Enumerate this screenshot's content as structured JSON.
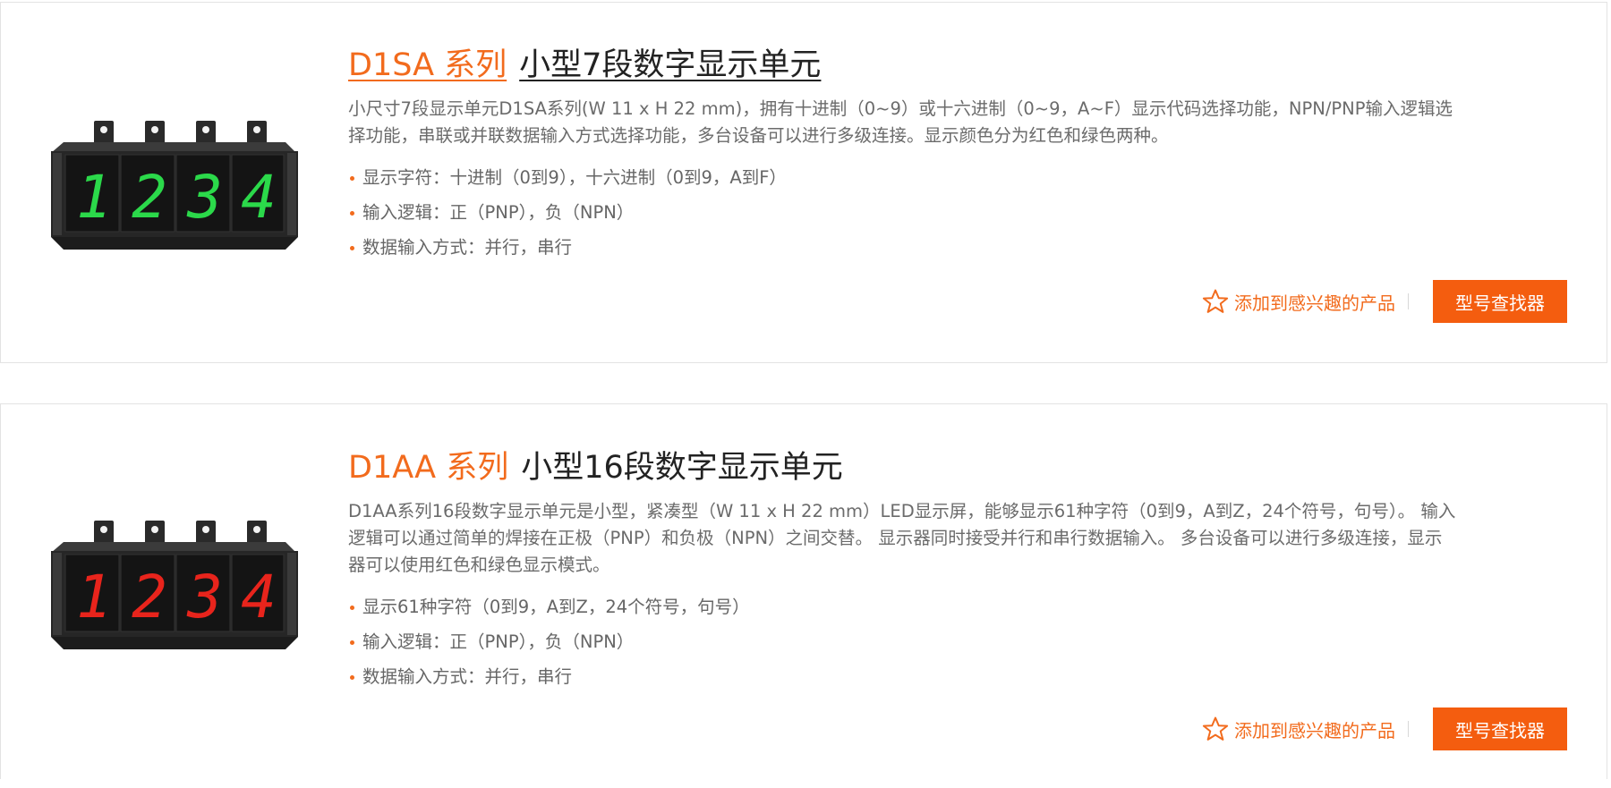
{
  "products": [
    {
      "series": "D1SA 系列",
      "subtitle": "小型7段数字显示单元",
      "description": "小尺寸7段显示单元D1SA系列(W 11 x H 22 mm)，拥有十进制（0~9）或十六进制（0~9，A~F）显示代码选择功能，NPN/PNP输入逻辑选择功能，串联或并联数据输入方式选择功能，多台设备可以进行多级连接。显示颜色分为红色和绿色两种。",
      "features": [
        "显示字符：十进制（0到9），十六进制（0到9，A到F）",
        "输入逻辑：正（PNP），负（NPN）",
        "数据输入方式：并行，串行"
      ],
      "display_digits": [
        "1",
        "2",
        "3",
        "4"
      ],
      "display_color": "#2bd94a",
      "favorite_label": "添加到感兴趣的产品",
      "finder_label": "型号查找器"
    },
    {
      "series": "D1AA 系列",
      "subtitle": "小型16段数字显示单元",
      "description": "D1AA系列16段数字显示单元是小型，紧凑型（W 11 x H 22 mm）LED显示屏，能够显示61种字符（0到9，A到Z，24个符号，句号）。 输入逻辑可以通过简单的焊接在正极（PNP）和负极（NPN）之间交替。 显示器同时接受并行和串行数据输入。 多台设备可以进行多级连接，显示器可以使用红色和绿色显示模式。",
      "features": [
        "显示61种字符（0到9，A到Z，24个符号，句号）",
        "输入逻辑：正（PNP），负（NPN）",
        "数据输入方式：并行，串行"
      ],
      "display_digits": [
        "1",
        "2",
        "3",
        "4"
      ],
      "display_color": "#e8241c",
      "favorite_label": "添加到感兴趣的产品",
      "finder_label": "型号查找器"
    }
  ],
  "colors": {
    "accent": "#f26b1d",
    "button": "#f45d0f"
  },
  "icons": {
    "favorite": "star-outline-icon"
  }
}
